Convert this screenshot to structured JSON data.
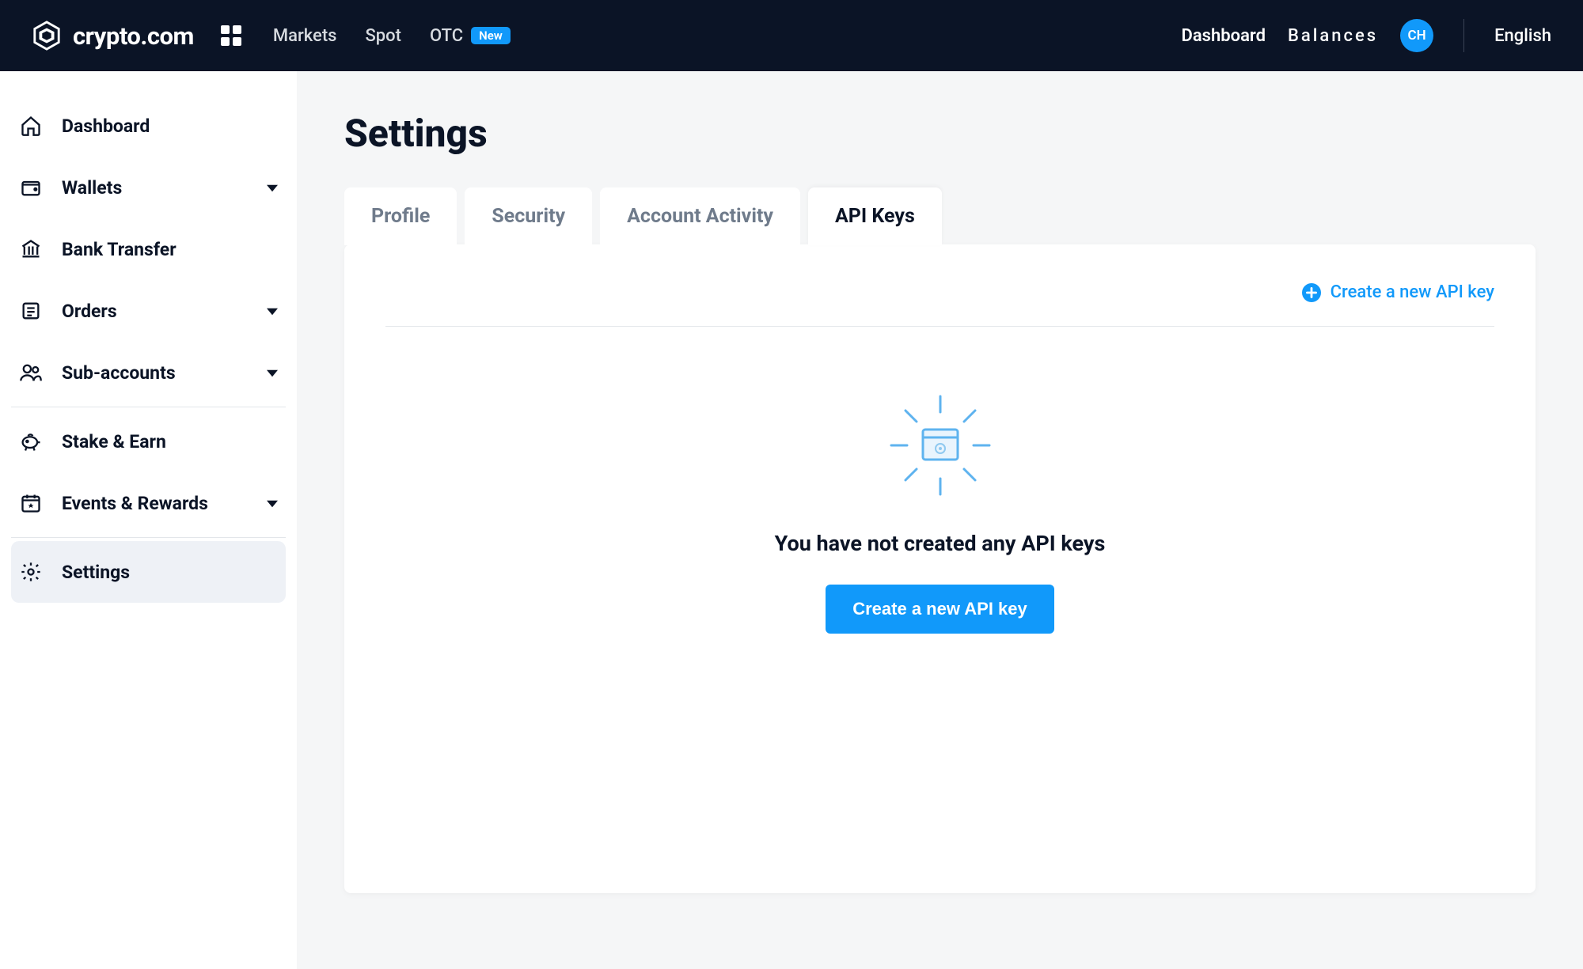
{
  "header": {
    "logo_text": "crypto.com",
    "nav": {
      "markets": "Markets",
      "spot": "Spot",
      "otc": "OTC",
      "otc_badge": "New"
    },
    "right": {
      "dashboard": "Dashboard",
      "balances": "Balances",
      "avatar_initials": "CH",
      "language": "English"
    }
  },
  "sidebar": {
    "dashboard": "Dashboard",
    "wallets": "Wallets",
    "bank_transfer": "Bank Transfer",
    "orders": "Orders",
    "sub_accounts": "Sub-accounts",
    "stake_earn": "Stake & Earn",
    "events_rewards": "Events & Rewards",
    "settings": "Settings"
  },
  "main": {
    "title": "Settings",
    "tabs": {
      "profile": "Profile",
      "security": "Security",
      "account_activity": "Account Activity",
      "api_keys": "API Keys"
    },
    "create_link": "Create a new API key",
    "empty_message": "You have not created any API keys",
    "create_button": "Create a new API key"
  }
}
